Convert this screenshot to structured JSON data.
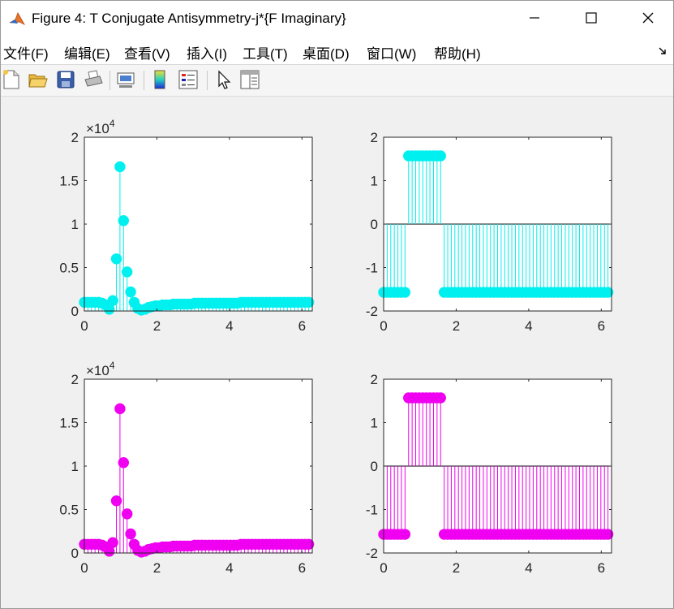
{
  "window": {
    "title": "Figure 4: T Conjugate Antisymmetry-j*{F Imaginary}",
    "controls": [
      "minimize",
      "maximize",
      "close"
    ]
  },
  "menubar": {
    "items": [
      "文件(F)",
      "编辑(E)",
      "查看(V)",
      "插入(I)",
      "工具(T)",
      "桌面(D)",
      "窗口(W)",
      "帮助(H)"
    ]
  },
  "toolbar": {
    "icons": [
      "new-figure-icon",
      "open-file-icon",
      "save-icon",
      "print-icon",
      "link-plot-icon",
      "insert-colorbar-icon",
      "insert-legend-icon",
      "pointer-icon",
      "property-inspector-icon"
    ]
  },
  "colors": {
    "cyan": "#00f0f0",
    "magenta": "#f000f0",
    "axes": "#000000",
    "figure_bg": "#f0f0f0"
  },
  "chart_data": [
    {
      "type": "stem",
      "color": "#00f0f0",
      "ylim": [
        0,
        2
      ],
      "y_exponent_label": "×10",
      "y_exponent_power": "4",
      "xlim": [
        0,
        6.2832
      ],
      "xticks": [
        "0",
        "2",
        "4",
        "6"
      ],
      "yticks": [
        "0",
        "0.5",
        "1",
        "1.5",
        "2"
      ],
      "description_of_series": "magnitude spectrum (values in units of 10^4)",
      "x": [
        0.0,
        0.0982,
        0.1963,
        0.2945,
        0.3927,
        0.4909,
        0.589,
        0.6872,
        0.7854,
        0.8836,
        0.9817,
        1.0799,
        1.1781,
        1.2763,
        1.3744,
        1.4726,
        1.5708,
        1.669,
        1.7671,
        1.8653,
        1.9635,
        2.0617,
        2.1598,
        2.258,
        2.3562,
        2.4544,
        2.5525,
        2.6507,
        2.7489,
        2.8471,
        2.9452,
        3.0434,
        3.1416,
        3.2398,
        3.3379,
        3.4361,
        3.5343,
        3.6325,
        3.7306,
        3.8288,
        3.927,
        4.0252,
        4.1233,
        4.2215,
        4.3197,
        4.4179,
        4.516,
        4.6142,
        4.7124,
        4.8106,
        4.9087,
        5.0069,
        5.1051,
        5.2033,
        5.3014,
        5.3996,
        5.4978,
        5.596,
        5.6941,
        5.7923,
        5.8905,
        5.9887,
        6.0868,
        6.185
      ],
      "y": [
        0.1,
        0.1,
        0.1,
        0.1,
        0.1,
        0.09,
        0.07,
        0.02,
        0.12,
        0.6,
        1.66,
        1.04,
        0.45,
        0.22,
        0.1,
        0.03,
        0.01,
        0.02,
        0.04,
        0.05,
        0.06,
        0.06,
        0.07,
        0.07,
        0.07,
        0.08,
        0.08,
        0.08,
        0.08,
        0.08,
        0.08,
        0.09,
        0.09,
        0.09,
        0.09,
        0.09,
        0.09,
        0.09,
        0.09,
        0.09,
        0.09,
        0.09,
        0.09,
        0.09,
        0.1,
        0.1,
        0.1,
        0.1,
        0.1,
        0.1,
        0.1,
        0.1,
        0.1,
        0.1,
        0.1,
        0.1,
        0.1,
        0.1,
        0.1,
        0.1,
        0.1,
        0.1,
        0.1,
        0.1
      ]
    },
    {
      "type": "stem",
      "color": "#00f0f0",
      "ylim": [
        -2,
        2
      ],
      "xlim": [
        0,
        6.2832
      ],
      "xticks": [
        "0",
        "2",
        "4",
        "6"
      ],
      "yticks": [
        "-2",
        "-1",
        "0",
        "1",
        "2"
      ],
      "description_of_series": "phase spectrum",
      "x": [
        0.0,
        0.0982,
        0.1963,
        0.2945,
        0.3927,
        0.4909,
        0.589,
        0.6872,
        0.7854,
        0.8836,
        0.9817,
        1.0799,
        1.1781,
        1.2763,
        1.3744,
        1.4726,
        1.5708,
        1.669,
        1.7671,
        1.8653,
        1.9635,
        2.0617,
        2.1598,
        2.258,
        2.3562,
        2.4544,
        2.5525,
        2.6507,
        2.7489,
        2.8471,
        2.9452,
        3.0434,
        3.1416,
        3.2398,
        3.3379,
        3.4361,
        3.5343,
        3.6325,
        3.7306,
        3.8288,
        3.927,
        4.0252,
        4.1233,
        4.2215,
        4.3197,
        4.4179,
        4.516,
        4.6142,
        4.7124,
        4.8106,
        4.9087,
        5.0069,
        5.1051,
        5.2033,
        5.3014,
        5.3996,
        5.4978,
        5.596,
        5.6941,
        5.7923,
        5.8905,
        5.9887,
        6.0868,
        6.185
      ],
      "y": [
        -1.5708,
        -1.5708,
        -1.5708,
        -1.5708,
        -1.5708,
        -1.5708,
        -1.5708,
        1.5708,
        1.5708,
        1.5708,
        1.5708,
        1.5708,
        1.5708,
        1.5708,
        1.5708,
        1.5708,
        1.5708,
        -1.5708,
        -1.5708,
        -1.5708,
        -1.5708,
        -1.5708,
        -1.5708,
        -1.5708,
        -1.5708,
        -1.5708,
        -1.5708,
        -1.5708,
        -1.5708,
        -1.5708,
        -1.5708,
        -1.5708,
        -1.5708,
        -1.5708,
        -1.5708,
        -1.5708,
        -1.5708,
        -1.5708,
        -1.5708,
        -1.5708,
        -1.5708,
        -1.5708,
        -1.5708,
        -1.5708,
        -1.5708,
        -1.5708,
        -1.5708,
        -1.5708,
        -1.5708,
        -1.5708,
        -1.5708,
        -1.5708,
        -1.5708,
        -1.5708,
        -1.5708,
        -1.5708,
        -1.5708,
        -1.5708,
        -1.5708,
        -1.5708,
        -1.5708,
        -1.5708,
        -1.5708,
        -1.5708
      ]
    },
    {
      "type": "stem",
      "color": "#f000f0",
      "ylim": [
        0,
        2
      ],
      "y_exponent_label": "×10",
      "y_exponent_power": "4",
      "xlim": [
        0,
        6.2832
      ],
      "xticks": [
        "0",
        "2",
        "4",
        "6"
      ],
      "yticks": [
        "0",
        "0.5",
        "1",
        "1.5",
        "2"
      ],
      "description_of_series": "magnitude spectrum (values in units of 10^4)",
      "x": [
        0.0,
        0.0982,
        0.1963,
        0.2945,
        0.3927,
        0.4909,
        0.589,
        0.6872,
        0.7854,
        0.8836,
        0.9817,
        1.0799,
        1.1781,
        1.2763,
        1.3744,
        1.4726,
        1.5708,
        1.669,
        1.7671,
        1.8653,
        1.9635,
        2.0617,
        2.1598,
        2.258,
        2.3562,
        2.4544,
        2.5525,
        2.6507,
        2.7489,
        2.8471,
        2.9452,
        3.0434,
        3.1416,
        3.2398,
        3.3379,
        3.4361,
        3.5343,
        3.6325,
        3.7306,
        3.8288,
        3.927,
        4.0252,
        4.1233,
        4.2215,
        4.3197,
        4.4179,
        4.516,
        4.6142,
        4.7124,
        4.8106,
        4.9087,
        5.0069,
        5.1051,
        5.2033,
        5.3014,
        5.3996,
        5.4978,
        5.596,
        5.6941,
        5.7923,
        5.8905,
        5.9887,
        6.0868,
        6.185
      ],
      "y": [
        0.1,
        0.1,
        0.1,
        0.1,
        0.1,
        0.09,
        0.07,
        0.02,
        0.12,
        0.6,
        1.66,
        1.04,
        0.45,
        0.22,
        0.1,
        0.03,
        0.01,
        0.02,
        0.04,
        0.05,
        0.06,
        0.06,
        0.07,
        0.07,
        0.07,
        0.08,
        0.08,
        0.08,
        0.08,
        0.08,
        0.08,
        0.09,
        0.09,
        0.09,
        0.09,
        0.09,
        0.09,
        0.09,
        0.09,
        0.09,
        0.09,
        0.09,
        0.09,
        0.09,
        0.1,
        0.1,
        0.1,
        0.1,
        0.1,
        0.1,
        0.1,
        0.1,
        0.1,
        0.1,
        0.1,
        0.1,
        0.1,
        0.1,
        0.1,
        0.1,
        0.1,
        0.1,
        0.1,
        0.1
      ]
    },
    {
      "type": "stem",
      "color": "#f000f0",
      "ylim": [
        -2,
        2
      ],
      "xlim": [
        0,
        6.2832
      ],
      "xticks": [
        "0",
        "2",
        "4",
        "6"
      ],
      "yticks": [
        "-2",
        "-1",
        "0",
        "1",
        "2"
      ],
      "description_of_series": "phase spectrum",
      "x": [
        0.0,
        0.0982,
        0.1963,
        0.2945,
        0.3927,
        0.4909,
        0.589,
        0.6872,
        0.7854,
        0.8836,
        0.9817,
        1.0799,
        1.1781,
        1.2763,
        1.3744,
        1.4726,
        1.5708,
        1.669,
        1.7671,
        1.8653,
        1.9635,
        2.0617,
        2.1598,
        2.258,
        2.3562,
        2.4544,
        2.5525,
        2.6507,
        2.7489,
        2.8471,
        2.9452,
        3.0434,
        3.1416,
        3.2398,
        3.3379,
        3.4361,
        3.5343,
        3.6325,
        3.7306,
        3.8288,
        3.927,
        4.0252,
        4.1233,
        4.2215,
        4.3197,
        4.4179,
        4.516,
        4.6142,
        4.7124,
        4.8106,
        4.9087,
        5.0069,
        5.1051,
        5.2033,
        5.3014,
        5.3996,
        5.4978,
        5.596,
        5.6941,
        5.7923,
        5.8905,
        5.9887,
        6.0868,
        6.185
      ],
      "y": [
        -1.5708,
        -1.5708,
        -1.5708,
        -1.5708,
        -1.5708,
        -1.5708,
        -1.5708,
        1.5708,
        1.5708,
        1.5708,
        1.5708,
        1.5708,
        1.5708,
        1.5708,
        1.5708,
        1.5708,
        1.5708,
        -1.5708,
        -1.5708,
        -1.5708,
        -1.5708,
        -1.5708,
        -1.5708,
        -1.5708,
        -1.5708,
        -1.5708,
        -1.5708,
        -1.5708,
        -1.5708,
        -1.5708,
        -1.5708,
        -1.5708,
        -1.5708,
        -1.5708,
        -1.5708,
        -1.5708,
        -1.5708,
        -1.5708,
        -1.5708,
        -1.5708,
        -1.5708,
        -1.5708,
        -1.5708,
        -1.5708,
        -1.5708,
        -1.5708,
        -1.5708,
        -1.5708,
        -1.5708,
        -1.5708,
        -1.5708,
        -1.5708,
        -1.5708,
        -1.5708,
        -1.5708,
        -1.5708,
        -1.5708,
        -1.5708,
        -1.5708,
        -1.5708,
        -1.5708,
        -1.5708,
        -1.5708,
        -1.5708
      ]
    }
  ]
}
